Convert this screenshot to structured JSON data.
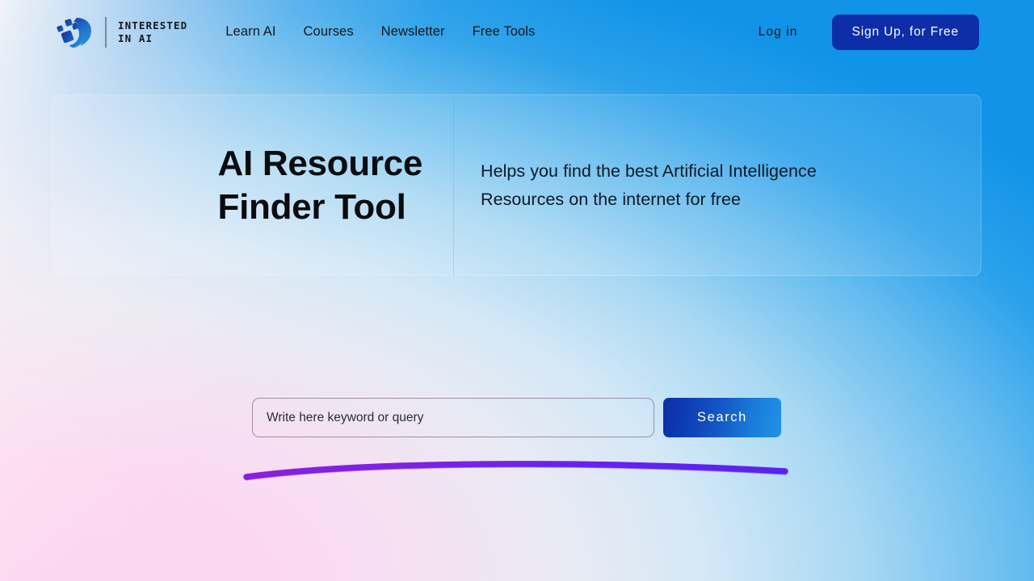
{
  "brand": {
    "name": "INTERESTED\nIN AI",
    "logo_icon": "interested-in-ai-logo"
  },
  "nav": {
    "items": [
      {
        "label": "Learn AI"
      },
      {
        "label": "Courses"
      },
      {
        "label": "Newsletter"
      },
      {
        "label": "Free Tools"
      }
    ]
  },
  "header_actions": {
    "login_label": "Log in",
    "signup_label": "Sign Up, for Free",
    "signup_bg": "#0d2ea8"
  },
  "hero": {
    "title": "AI Resource\nFinder Tool",
    "subtitle": "Helps you find the best Artificial Intelligence\nResources on the internet for free"
  },
  "search": {
    "placeholder": "Write here keyword or query",
    "value": "",
    "button_label": "Search"
  },
  "decoration": {
    "swoosh_color_start": "#7b1fe0",
    "swoosh_color_end": "#5a22f0"
  },
  "theme": {
    "bg_left": "#fdd3ef",
    "bg_right": "#1193e8",
    "bg_top_left": "#fdf8f9",
    "text_dark": "#0b0c0f"
  }
}
